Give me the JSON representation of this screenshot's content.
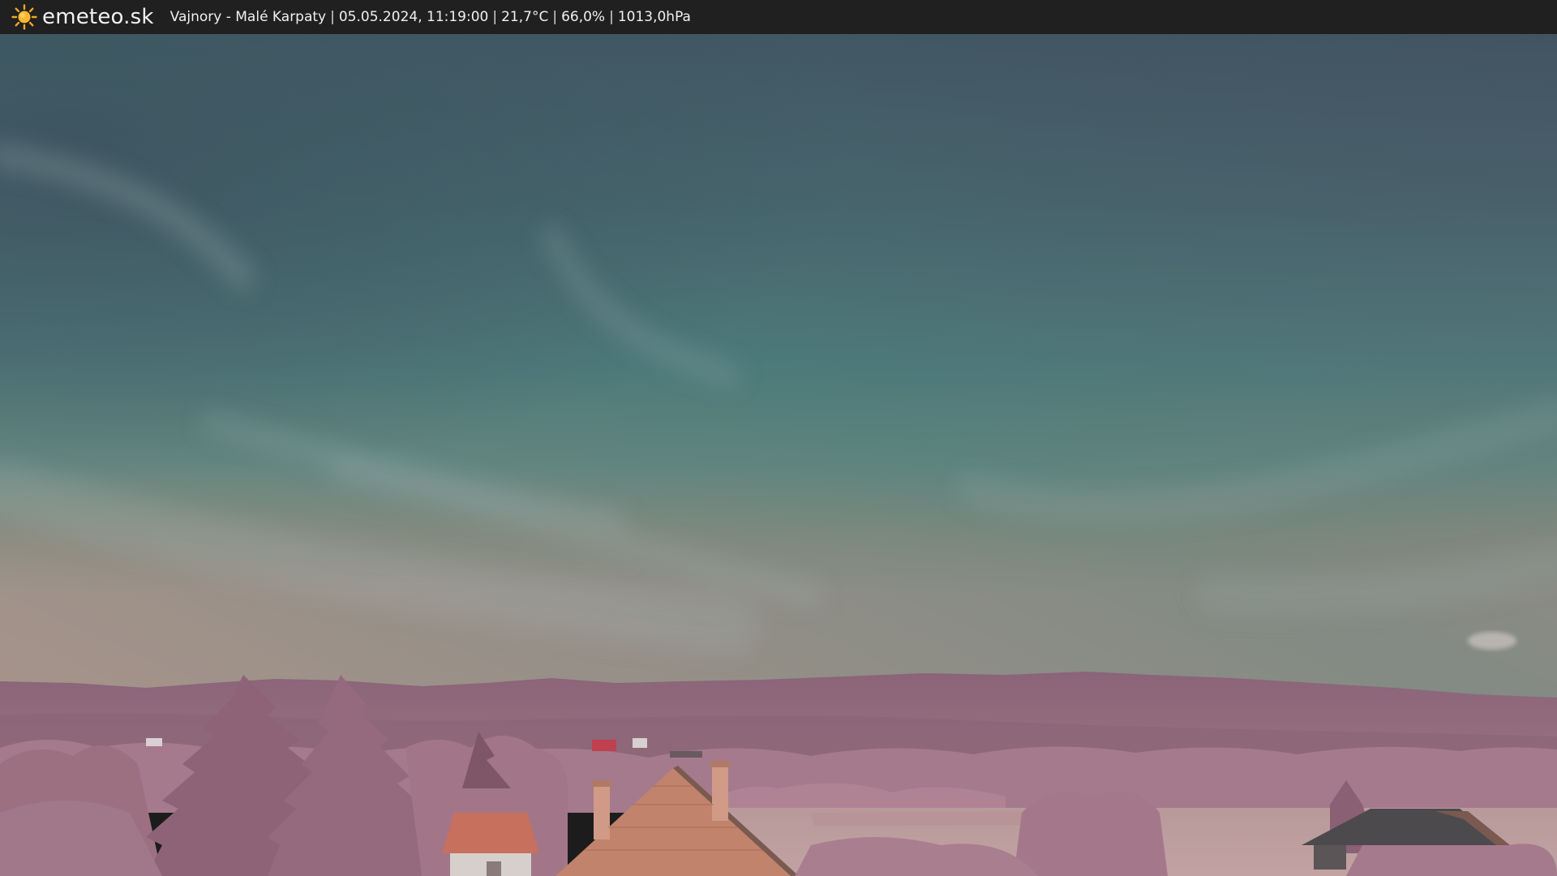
{
  "header": {
    "site_name": "emeteo.sk",
    "logo_icon": "sun-icon",
    "location": "Vajnory - Malé Karpaty",
    "datetime": "05.05.2024, 11:19:00",
    "temperature": "21,7°C",
    "humidity": "66,0%",
    "pressure": "1013,0hPa",
    "separator": "|"
  },
  "colors": {
    "bar_background": "#202020",
    "bar_text": "#f0f0f0",
    "sun": "#f5a623"
  }
}
